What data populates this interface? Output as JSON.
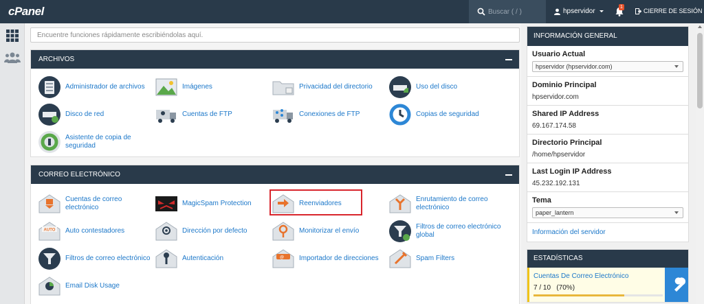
{
  "header": {
    "logo": "cPanel",
    "search_placeholder": "Buscar ( / )",
    "user": "hpservidor",
    "notifications_count": "1",
    "logout_label": "CIERRE DE SESIÓN"
  },
  "main": {
    "quick_search_placeholder": "Encuentre funciones rápidamente escribiéndolas aquí.",
    "archivos": {
      "title": "ARCHIVOS",
      "items": [
        {
          "label": "Administrador de archivos",
          "icon": "file-manager-icon"
        },
        {
          "label": "Imágenes",
          "icon": "images-icon"
        },
        {
          "label": "Privacidad del directorio",
          "icon": "directory-privacy-icon"
        },
        {
          "label": "Uso del disco",
          "icon": "disk-usage-icon"
        },
        {
          "label": "Disco de red",
          "icon": "network-disk-icon"
        },
        {
          "label": "Cuentas de FTP",
          "icon": "ftp-accounts-icon"
        },
        {
          "label": "Conexiones de FTP",
          "icon": "ftp-connections-icon"
        },
        {
          "label": "Copias de seguridad",
          "icon": "backup-icon"
        },
        {
          "label": "Asistente de copia de seguridad",
          "icon": "backup-wizard-icon"
        }
      ]
    },
    "correo": {
      "title": "CORREO ELECTRÓNICO",
      "items": [
        {
          "label": "Cuentas de correo electrónico",
          "icon": "email-accounts-icon"
        },
        {
          "label": "MagicSpam Protection",
          "icon": "magicspam-icon"
        },
        {
          "label": "Reenviadores",
          "icon": "forwarders-icon"
        },
        {
          "label": "Enrutamiento de correo electrónico",
          "icon": "email-routing-icon"
        },
        {
          "label": "Auto contestadores",
          "icon": "autoresponders-icon"
        },
        {
          "label": "Dirección por defecto",
          "icon": "default-address-icon"
        },
        {
          "label": "Monitorizar el envío",
          "icon": "track-delivery-icon"
        },
        {
          "label": "Filtros de correo electrónico global",
          "icon": "global-filters-icon"
        },
        {
          "label": "Filtros de correo electrónico",
          "icon": "email-filters-icon"
        },
        {
          "label": "Autenticación",
          "icon": "authentication-icon"
        },
        {
          "label": "Importador de direcciones",
          "icon": "address-importer-icon"
        },
        {
          "label": "Spam Filters",
          "icon": "spam-filters-icon"
        },
        {
          "label": "Email Disk Usage",
          "icon": "email-disk-usage-icon"
        }
      ]
    }
  },
  "sidebar_right": {
    "info_title": "INFORMACIÓN GENERAL",
    "current_user_label": "Usuario Actual",
    "current_user_value": "hpservidor (hpservidor.com)",
    "main_domain_label": "Dominio Principal",
    "main_domain_value": "hpservidor.com",
    "shared_ip_label": "Shared IP Address",
    "shared_ip_value": "69.167.174.58",
    "home_dir_label": "Directorio Principal",
    "home_dir_value": "/home/hpservidor",
    "last_login_label": "Last Login IP Address",
    "last_login_value": "45.232.192.131",
    "theme_label": "Tema",
    "theme_value": "paper_lantern",
    "server_info_link": "Información del servidor",
    "stats_title": "ESTADÍSTICAS",
    "email_accounts_stat_label": "Cuentas De Correo Electrónico",
    "email_accounts_stat_value": "7 / 10   (70%)",
    "email_accounts_fraction": 0.7
  },
  "colors": {
    "navy": "#293a4a",
    "link": "#1b77c9",
    "highlight": "#d8242b"
  }
}
